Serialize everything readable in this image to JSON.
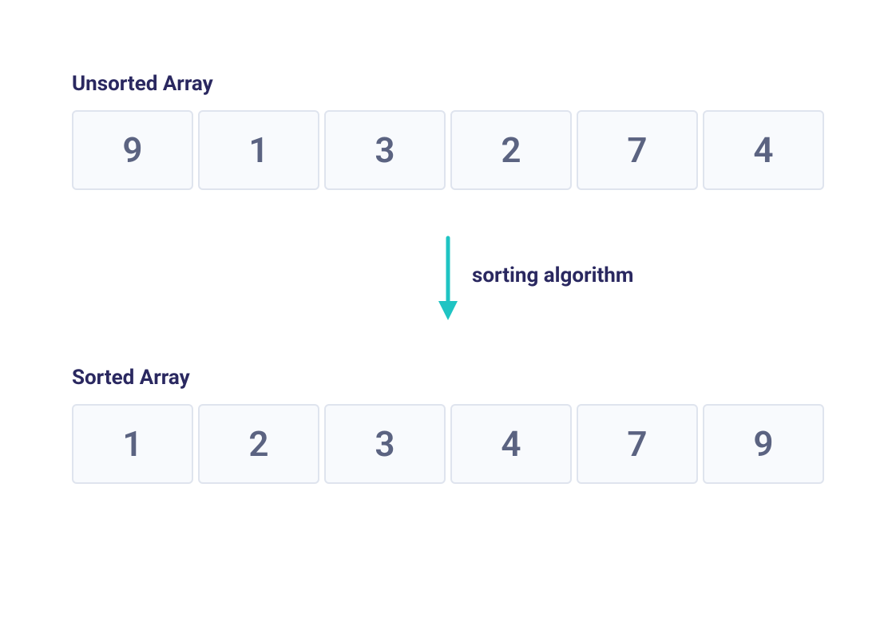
{
  "unsorted": {
    "label": "Unsorted Array",
    "values": [
      "9",
      "1",
      "3",
      "2",
      "7",
      "4"
    ]
  },
  "arrow": {
    "label": "sorting algorithm",
    "color": "#1fc4c3"
  },
  "sorted": {
    "label": "Sorted Array",
    "values": [
      "1",
      "2",
      "3",
      "4",
      "7",
      "9"
    ]
  },
  "colors": {
    "textDark": "#2a2860",
    "cellText": "#5b6381",
    "cellBg": "#f8fafd",
    "cellBorder": "#dfe4ee"
  }
}
